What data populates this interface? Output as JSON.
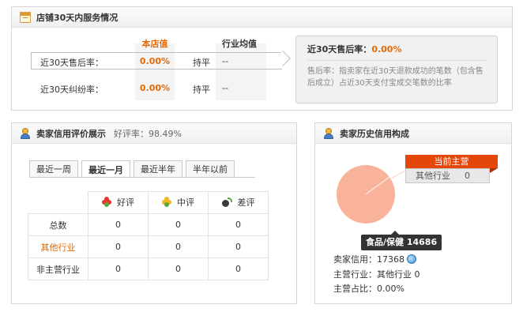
{
  "service": {
    "title": "店铺30天内服务情况",
    "col_store": "本店值",
    "col_industry": "行业均值",
    "rows": [
      {
        "label": "近30天售后率：",
        "value": "0.00%",
        "compare": "持平",
        "industry": "--"
      },
      {
        "label": "近30天纠纷率：",
        "value": "0.00%",
        "compare": "持平",
        "industry": "--"
      }
    ],
    "tip": {
      "title_prefix": "近30天售后率：",
      "title_value": "0.00%",
      "desc": "售后率：指卖家在近30天退款成功的笔数（包含售后成立）占近30天支付宝成交笔数的比率"
    }
  },
  "rating": {
    "title": "卖家信用评价展示",
    "good_rate_label": "好评率：98.49%",
    "tabs": [
      "最近一周",
      "最近一月",
      "最近半年",
      "半年以前"
    ],
    "active_tab": 1,
    "headers": [
      "好评",
      "中评",
      "差评"
    ],
    "rows": [
      {
        "label": "总数",
        "values": [
          "0",
          "0",
          "0"
        ]
      },
      {
        "label": "其他行业",
        "values": [
          "0",
          "0",
          "0"
        ]
      },
      {
        "label": "非主营行业",
        "values": [
          "0",
          "0",
          "0"
        ]
      }
    ]
  },
  "history": {
    "title": "卖家历史信用构成",
    "current_main": "当前主营",
    "main_industry_name": "其他行业",
    "main_industry_value": "0",
    "pie_tooltip": "食品/保健 14686",
    "credit_label": "卖家信用：",
    "credit_value": "17368",
    "main_label": "主营行业：",
    "main_value": "其他行业 0",
    "ratio_label": "主营占比：",
    "ratio_value": "0.00%"
  },
  "chart_data": {
    "type": "pie",
    "slices": [
      {
        "label": "食品/保健",
        "value": 14686
      }
    ]
  },
  "colors": {
    "accent_orange": "#e36b0a",
    "badge_red": "#e5470a",
    "pie_fill": "#f9b39a"
  }
}
